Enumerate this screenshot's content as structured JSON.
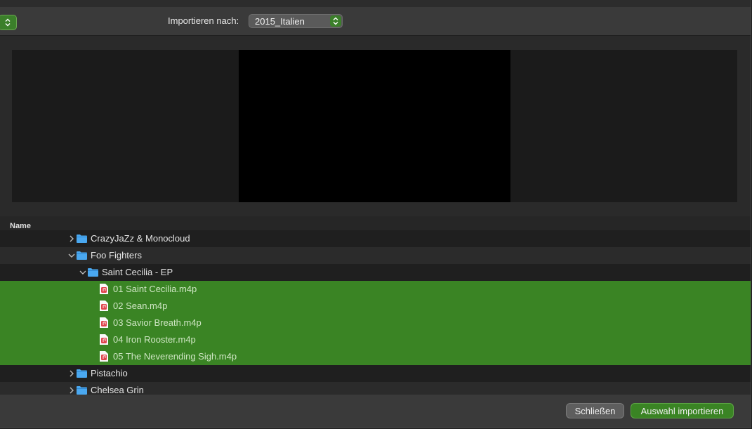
{
  "toolbar": {
    "import_label": "Importieren nach:",
    "import_target": "2015_Italien"
  },
  "list": {
    "header_name": "Name",
    "rows": [
      {
        "label": "CrazyJaZz & Monocloud",
        "type": "folder",
        "expanded": false
      },
      {
        "label": "Foo Fighters",
        "type": "folder",
        "expanded": true
      },
      {
        "label": "Saint Cecilia - EP",
        "type": "folder",
        "expanded": true
      },
      {
        "label": "01 Saint Cecilia.m4p",
        "type": "file",
        "selected": true
      },
      {
        "label": "02 Sean.m4p",
        "type": "file",
        "selected": true
      },
      {
        "label": "03 Savior Breath.m4p",
        "type": "file",
        "selected": true
      },
      {
        "label": "04 Iron Rooster.m4p",
        "type": "file",
        "selected": true
      },
      {
        "label": "05 The Neverending Sigh.m4p",
        "type": "file",
        "selected": true
      },
      {
        "label": "Pistachio",
        "type": "folder",
        "expanded": false
      },
      {
        "label": "Chelsea Grin",
        "type": "folder",
        "expanded": false
      }
    ]
  },
  "footer": {
    "close_label": "Schließen",
    "import_label": "Auswahl importieren"
  },
  "colors": {
    "accent_green": "#3a8424",
    "folder_blue": "#4aa8f0",
    "file_red": "#e0444c"
  },
  "icons": {
    "folder": "folder-icon",
    "file": "audio-file-icon",
    "expand": "chevron-down-icon",
    "collapse": "chevron-right-icon",
    "popup": "up-down-chevron-icon"
  }
}
